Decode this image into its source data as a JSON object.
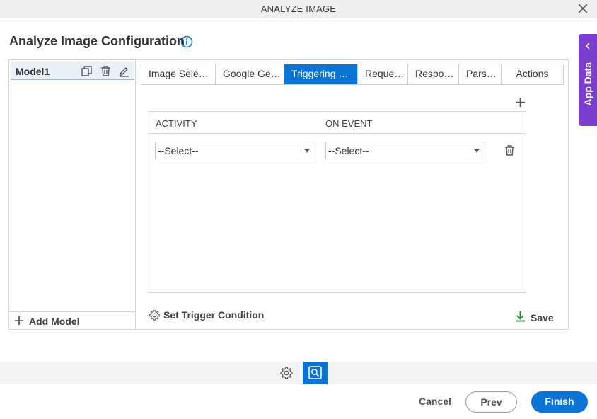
{
  "window": {
    "title": "ANALYZE IMAGE",
    "close_icon": "close-icon"
  },
  "header": {
    "title": "Analyze Image Configuration",
    "info_icon": "info-icon"
  },
  "app_data_tab": {
    "label": "App Data",
    "color": "#7b3fd0"
  },
  "models": {
    "items": [
      {
        "name": "Model1",
        "icons": [
          "copy-icon",
          "delete-icon",
          "edit-icon"
        ]
      }
    ],
    "add_label": "Add Model"
  },
  "tabs": [
    {
      "label": "Image Sele…",
      "active": false
    },
    {
      "label": "Google Ge…",
      "active": false
    },
    {
      "label": "Triggering …",
      "active": true
    },
    {
      "label": "Reque…",
      "active": false
    },
    {
      "label": "Respo…",
      "active": false
    },
    {
      "label": "Pars…",
      "active": false
    },
    {
      "label": "Actions",
      "active": false
    }
  ],
  "trigger_table": {
    "columns": [
      "ACTIVITY",
      "ON EVENT"
    ],
    "rows": [
      {
        "activity": "--Select--",
        "on_event": "--Select--"
      }
    ]
  },
  "actions": {
    "set_trigger_label": "Set Trigger Condition",
    "save_label": "Save"
  },
  "footer": {
    "cancel_label": "Cancel",
    "prev_label": "Prev",
    "finish_label": "Finish"
  },
  "colors": {
    "accent": "#0a73d6",
    "save_icon": "#1e8a3c"
  }
}
